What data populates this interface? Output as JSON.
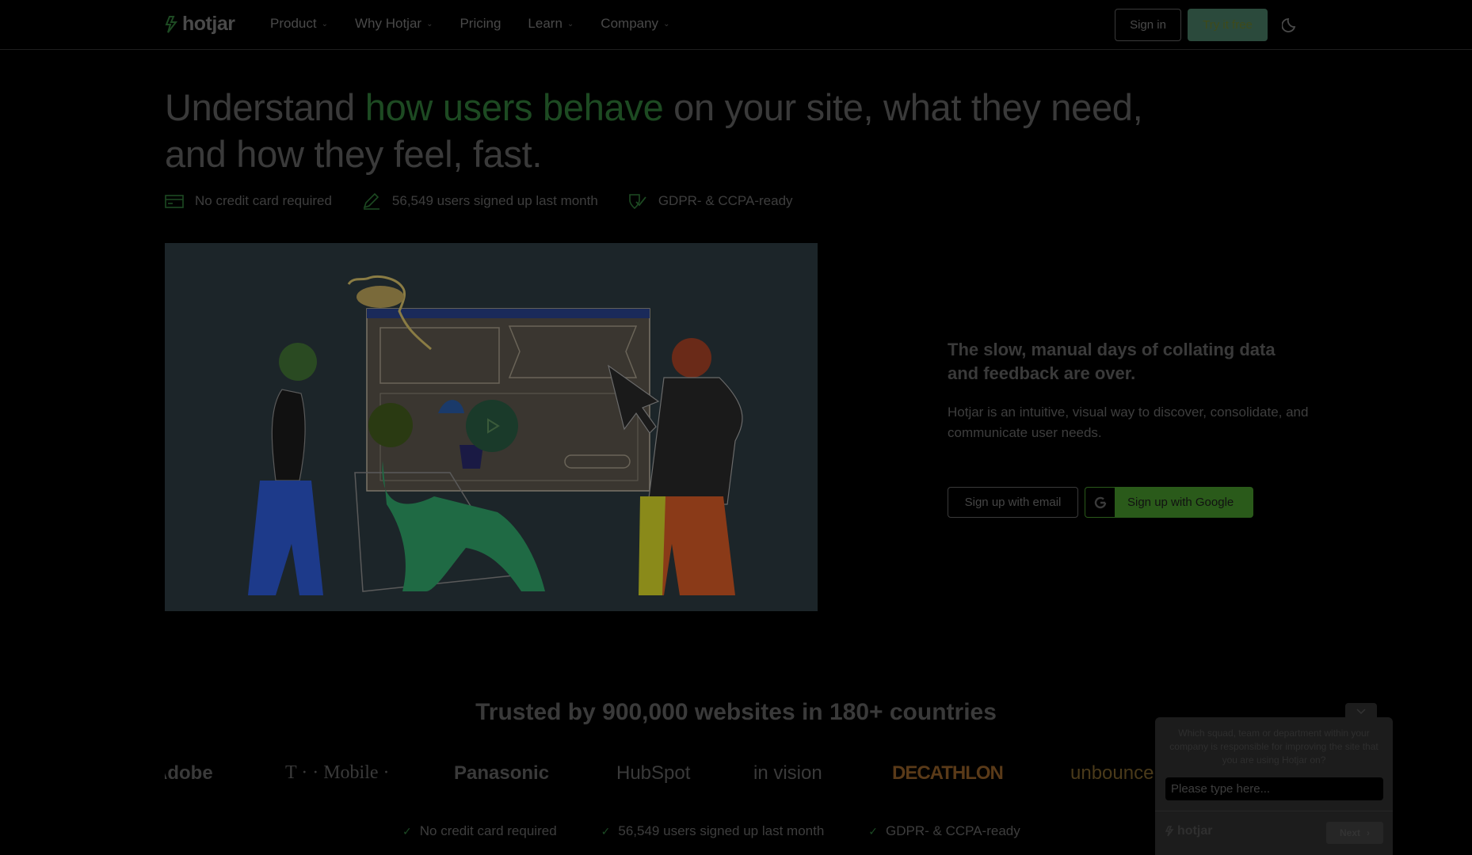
{
  "nav": {
    "brand": "hotjar",
    "links": [
      {
        "label": "Product",
        "caret": "⌄"
      },
      {
        "label": "Why Hotjar",
        "caret": "⌄"
      },
      {
        "label": "Pricing",
        "caret": ""
      },
      {
        "label": "Learn",
        "caret": "⌄"
      },
      {
        "label": "Company",
        "caret": "⌄"
      }
    ],
    "sign_in": "Sign in",
    "try_free": "Try it free"
  },
  "hero": {
    "title_pre": "Understand ",
    "title_accent": "how users behave",
    "title_post": " on your site, what they need, and how they feel, fast.",
    "features": [
      "No credit card required",
      "56,549 users signed up last month",
      "GDPR- & CCPA-ready"
    ]
  },
  "aside": {
    "heading": "The slow, manual days of collating data and feedback are over.",
    "body": "Hotjar is an intuitive, visual way to discover, consolidate, and communicate user needs.",
    "email_button": "Sign up with email",
    "google_button": "Sign up with Google"
  },
  "trusted": {
    "heading": "Trusted by 900,000 websites in 180+ countries",
    "logos": [
      "Adobe",
      "T · · Mobile ·",
      "Panasonic",
      "HubSpot",
      "in vision",
      "DECATHLON",
      "unbounce"
    ]
  },
  "bottom_features": [
    "No credit card required",
    "56,549 users signed up last month",
    "GDPR- & CCPA-ready"
  ],
  "widget": {
    "question": "Which squad, team or department within your company is responsible for improving the site that you are using Hotjar on?",
    "placeholder": "Please type here...",
    "brand": "hotjar",
    "next": "Next"
  },
  "colors": {
    "accent_green": "#1d4a22",
    "cta_green": "#2b4a3c",
    "google_green": "#2a5a1a"
  }
}
